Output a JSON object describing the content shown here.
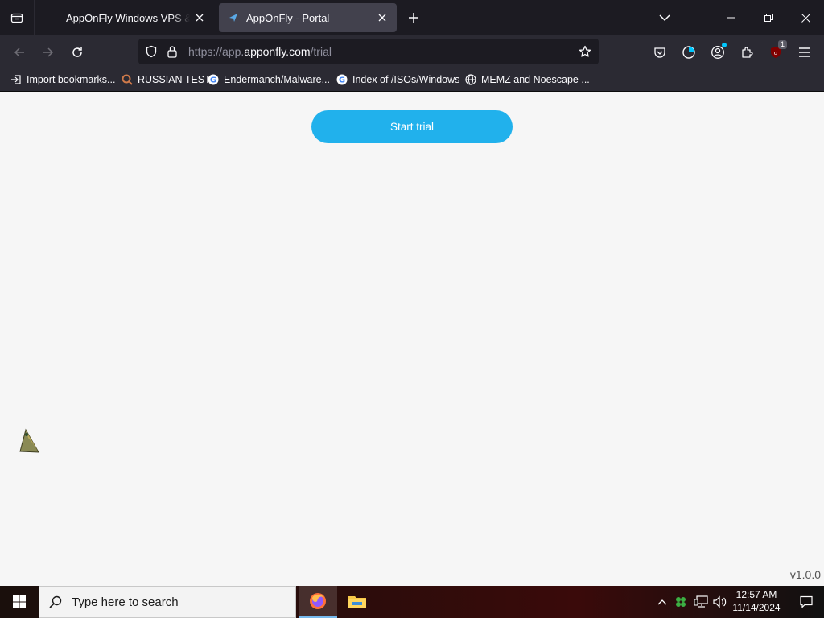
{
  "browser": {
    "tabs": [
      {
        "title": "AppOnFly Windows VPS & Cloud",
        "active": false
      },
      {
        "title": "AppOnFly - Portal",
        "active": true
      }
    ],
    "address": {
      "scheme": "https://app.",
      "host": "apponfly.com",
      "path": "/trial"
    },
    "extension_badge": "1",
    "bookmarks": [
      {
        "label": "Import bookmarks...",
        "icon": "import-icon"
      },
      {
        "label": "RUSSIAN TEST",
        "icon": "magnifier-icon"
      },
      {
        "label": "Endermanch/Malware...",
        "icon": "google-icon"
      },
      {
        "label": "Index of /ISOs/Windows",
        "icon": "google-icon"
      },
      {
        "label": "MEMZ and Noescape ...",
        "icon": "globe-icon"
      }
    ]
  },
  "page": {
    "start_trial_label": "Start trial",
    "version": "v1.0.0"
  },
  "taskbar": {
    "search_placeholder": "Type here to search",
    "time": "12:57 AM",
    "date": "11/14/2024"
  },
  "colors": {
    "accent_button": "#21b1ec",
    "page_background": "#f6f6f6",
    "browser_chrome": "#2b2a33"
  }
}
